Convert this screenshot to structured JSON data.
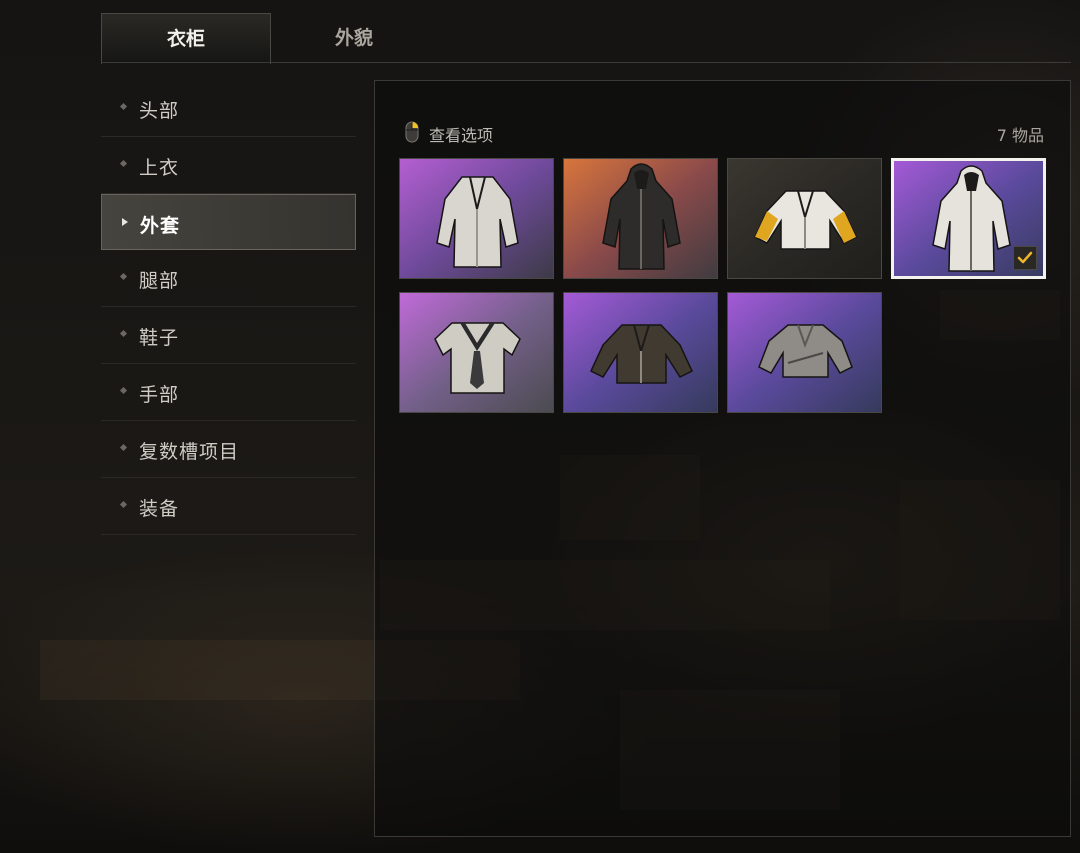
{
  "tabs": [
    {
      "label": "衣柜",
      "active": true
    },
    {
      "label": "外貌",
      "active": false
    }
  ],
  "sidebar": {
    "items": [
      {
        "label": "头部"
      },
      {
        "label": "上衣"
      },
      {
        "label": "外套",
        "active": true
      },
      {
        "label": "腿部"
      },
      {
        "label": "鞋子"
      },
      {
        "label": "手部"
      },
      {
        "label": "复数槽项目"
      },
      {
        "label": "装备"
      }
    ]
  },
  "main": {
    "view_options_label": "查看选项",
    "view_options_icon": "mouse-icon",
    "item_count": "7 物品",
    "items": [
      {
        "name": "white-long-coat",
        "bg": "purple",
        "garment": "trench",
        "color": "#d9d6cf"
      },
      {
        "name": "black-hooded-coat",
        "bg": "orange",
        "garment": "hooded-trench",
        "color": "#2e2c2a"
      },
      {
        "name": "yellow-white-jacket",
        "bg": "dark",
        "garment": "jacket",
        "color": "#e9e6df"
      },
      {
        "name": "white-hooded-coat",
        "bg": "purple-blue",
        "garment": "hooded-trench",
        "color": "#e6e3dc",
        "selected": true
      },
      {
        "name": "sailor-top",
        "bg": "purple-gray",
        "garment": "sailor",
        "color": "#cfccc4"
      },
      {
        "name": "studded-leather-jacket",
        "bg": "purple-blue",
        "garment": "jacket",
        "color": "#403a31"
      },
      {
        "name": "gray-cropped-jacket",
        "bg": "purple-blue",
        "garment": "cropped",
        "color": "#8f8c87"
      }
    ]
  },
  "colors": {
    "accent_check": "#f0b52a",
    "selected_border": "#f4f2ec"
  }
}
